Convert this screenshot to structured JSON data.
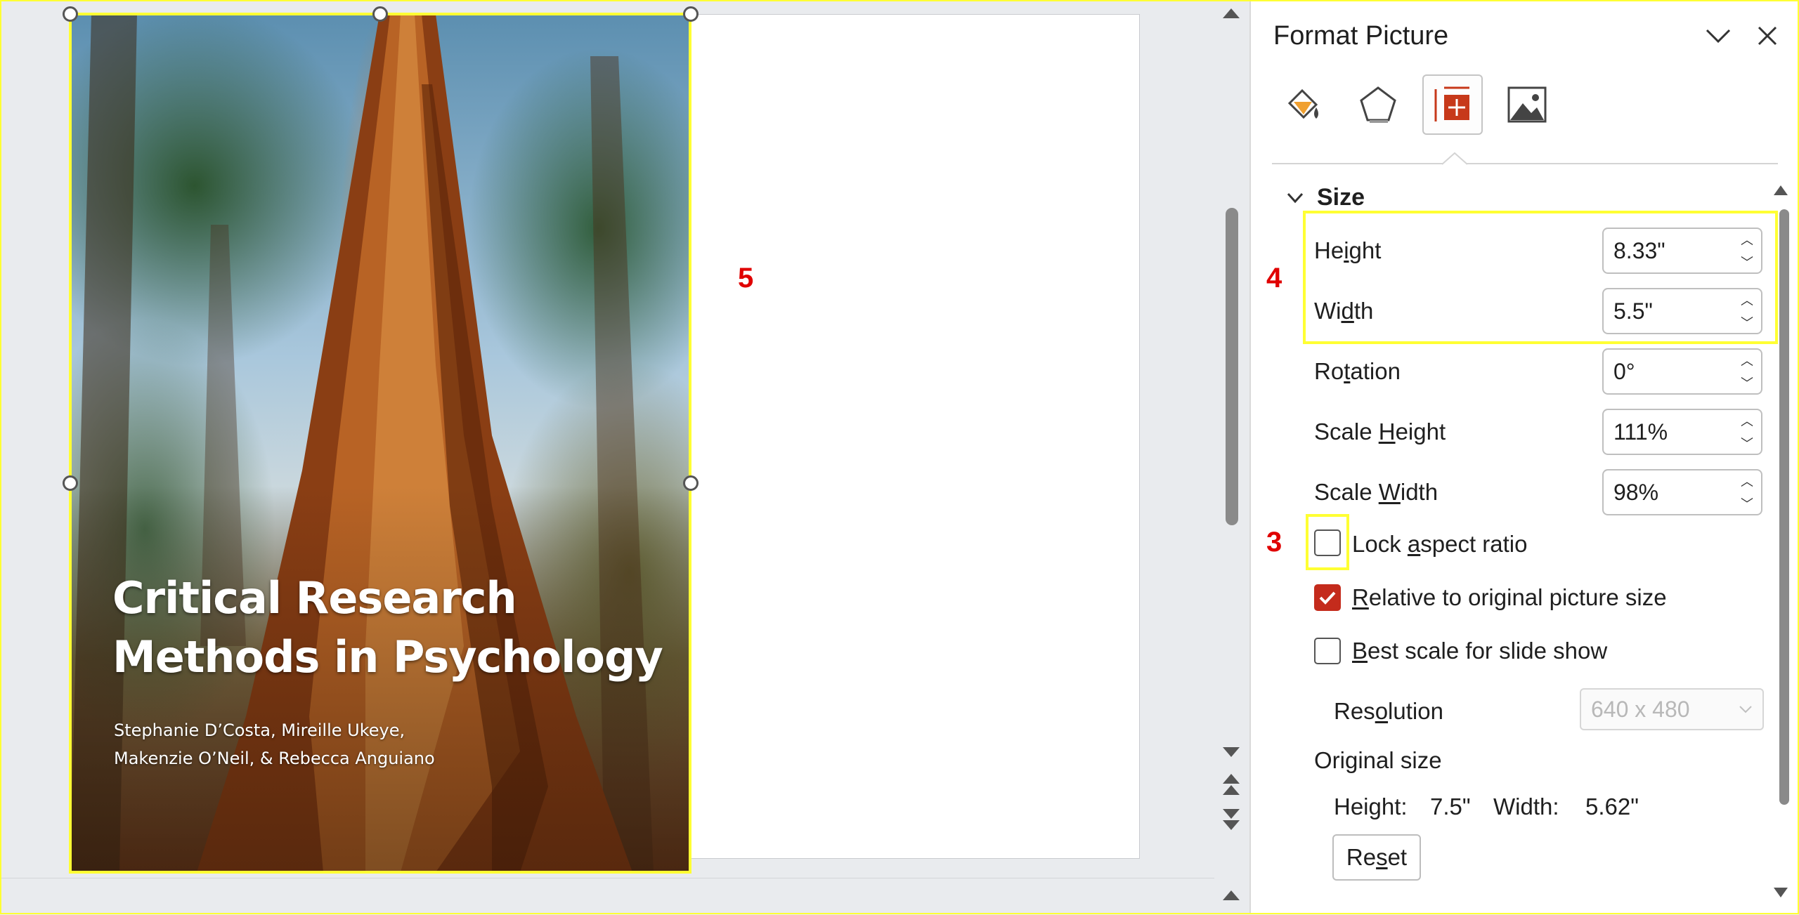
{
  "slide": {
    "callout_5": "5",
    "book": {
      "title_line1": "Critical Research",
      "title_line2": "Methods in Psychology",
      "authors_line1": "Stephanie D’Costa, Mireille Ukeye,",
      "authors_line2": "Makenzie O’Neil, & Rebecca Anguiano"
    }
  },
  "pane": {
    "title": "Format Picture",
    "tabs": [
      {
        "icon": "fill-line-icon"
      },
      {
        "icon": "effects-icon"
      },
      {
        "icon": "size-properties-icon",
        "active": true
      },
      {
        "icon": "picture-icon"
      }
    ],
    "section": "Size",
    "callout_4": "4",
    "callout_3": "3",
    "height": {
      "label_pre": "He",
      "label_u": "i",
      "label_post": "ght",
      "value": "8.33\""
    },
    "width": {
      "label_pre": "Wi",
      "label_u": "d",
      "label_post": "th",
      "value": "5.5\""
    },
    "rotation": {
      "label_pre": "Ro",
      "label_u": "t",
      "label_post": "ation",
      "value": "0°"
    },
    "scale_height": {
      "label_pre": "Scale ",
      "label_u": "H",
      "label_post": "eight",
      "value": "111%"
    },
    "scale_width": {
      "label_pre": "Scale ",
      "label_u": "W",
      "label_post": "idth",
      "value": "98%"
    },
    "lock_aspect": {
      "label_pre": "Lock ",
      "label_u": "a",
      "label_post": "spect ratio",
      "checked": false
    },
    "relative": {
      "label_pre": "",
      "label_u": "R",
      "label_post": "elative to original picture size",
      "checked": true
    },
    "best_scale": {
      "label_pre": "",
      "label_u": "B",
      "label_post": "est scale for slide show",
      "checked": false
    },
    "resolution": {
      "label_pre": "Res",
      "label_u": "o",
      "label_post": "lution",
      "value": "640 x 480"
    },
    "original_size": {
      "label": "Original size",
      "height_label": "Height:",
      "height_value": "7.5\"",
      "width_label": "Width:",
      "width_value": "5.62\""
    },
    "reset": {
      "label_pre": "Re",
      "label_u": "s",
      "label_post": "et"
    }
  }
}
